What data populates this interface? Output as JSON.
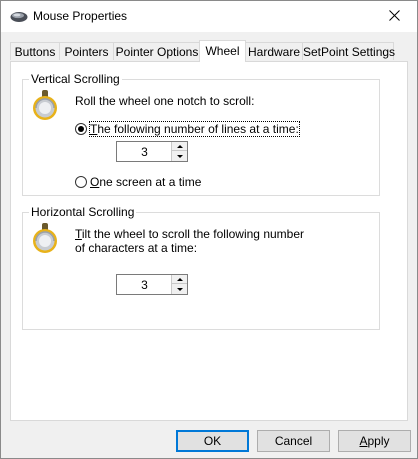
{
  "window": {
    "title": "Mouse Properties",
    "title_icon": "mouse-icon",
    "close_icon": "close-icon"
  },
  "tabs": [
    {
      "label": "Buttons",
      "active": false
    },
    {
      "label": "Pointers",
      "active": false
    },
    {
      "label": "Pointer Options",
      "active": false
    },
    {
      "label": "Wheel",
      "active": true
    },
    {
      "label": "Hardware",
      "active": false
    },
    {
      "label": "SetPoint Settings",
      "active": false
    }
  ],
  "vertical": {
    "legend": "Vertical Scrolling",
    "icon": "scroll-wheel-icon",
    "intro": "Roll the wheel one notch to scroll:",
    "option_lines_prefix": "",
    "option_lines_accel": "T",
    "option_lines_rest": "he following number of lines at a time:",
    "option_lines_checked": true,
    "lines_value": "3",
    "option_screen_accel": "O",
    "option_screen_rest": "ne screen at a time",
    "option_screen_checked": false
  },
  "horizontal": {
    "legend": "Horizontal Scrolling",
    "icon": "scroll-wheel-icon",
    "line1_accel": "T",
    "line1_rest": "ilt the wheel to scroll the following number",
    "line2": "of characters at a time:",
    "chars_value": "3"
  },
  "buttons": {
    "ok": "OK",
    "cancel": "Cancel",
    "apply_accel": "A",
    "apply_rest": "pply"
  },
  "colors": {
    "accent": "#0078d7",
    "tab_border": "#d9d9d9",
    "panel_bg": "#ffffff",
    "window_bg": "#f0f0f0"
  }
}
